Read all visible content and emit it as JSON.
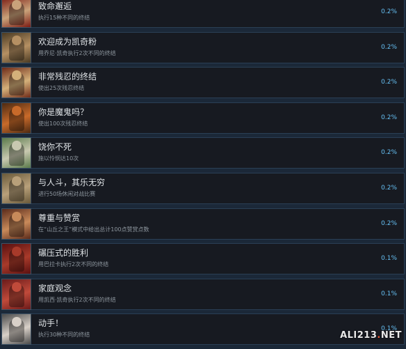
{
  "achievements": [
    {
      "title": "致命邂逅",
      "desc": "执行15种不同的终结",
      "percent": "0.2%",
      "colors": [
        "#7a1a12",
        "#c9a27a"
      ]
    },
    {
      "title": "欢迎成为凯奇粉",
      "desc": "用乔尼·凯奇执行2次不同的终结",
      "percent": "0.2%",
      "colors": [
        "#4a3a22",
        "#b59063"
      ]
    },
    {
      "title": "非常残忍的终结",
      "desc": "使出25次残忍终结",
      "percent": "0.2%",
      "colors": [
        "#6e2a18",
        "#d4b07a"
      ]
    },
    {
      "title": "你是魔鬼吗？",
      "desc": "使出100次残忍终结",
      "percent": "0.2%",
      "colors": [
        "#4c2a12",
        "#c86a2a"
      ]
    },
    {
      "title": "饶你不死",
      "desc": "施以怜悯达10次",
      "percent": "0.2%",
      "colors": [
        "#5a7a4a",
        "#c8c8b0"
      ]
    },
    {
      "title": "与人斗，其乐无穷",
      "desc": "进行50场休闲对战比赛",
      "percent": "0.2%",
      "colors": [
        "#6a5a3a",
        "#b8a07a"
      ]
    },
    {
      "title": "尊重与赞赏",
      "desc": "在“山丘之王”模式中给出总计100点赞赏点数",
      "percent": "0.2%",
      "colors": [
        "#5a2a1a",
        "#c88a5a"
      ]
    },
    {
      "title": "碾压式的胜利",
      "desc": "用巴拉卡执行2次不同的终结",
      "percent": "0.1%",
      "colors": [
        "#5a1010",
        "#a83a2a"
      ]
    },
    {
      "title": "家庭观念",
      "desc": "用凯西·凯奇执行2次不同的终结",
      "percent": "0.1%",
      "colors": [
        "#6a1a1a",
        "#c04a3a"
      ]
    },
    {
      "title": "动手！",
      "desc": "执行30种不同的终结",
      "percent": "0.1%",
      "colors": [
        "#4a4a4a",
        "#d8d0c8"
      ]
    }
  ],
  "watermark": {
    "text": "ALI213.NET"
  }
}
